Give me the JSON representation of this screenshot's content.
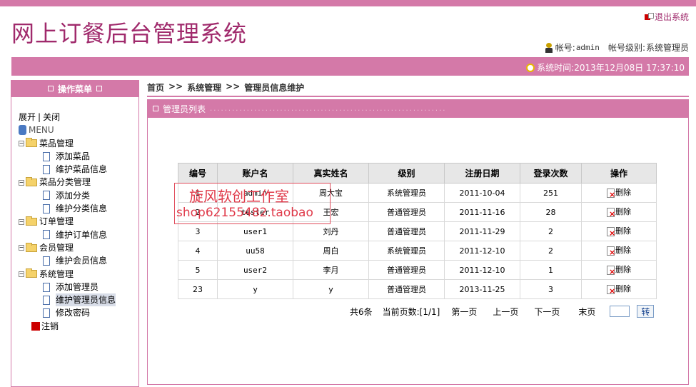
{
  "header": {
    "title": "网上订餐后台管理系统",
    "logout": "退出系统",
    "account_label": "帐号:",
    "account_value": "admin",
    "level_label": "帐号级别:",
    "level_value": "系统管理员",
    "systime_label": "系统时间:",
    "systime_value": "2013年12月08日 17:37:10"
  },
  "sidebar": {
    "title": "操作菜单",
    "expand": "展开",
    "collapse": "关闭",
    "root": "MENU",
    "groups": [
      {
        "label": "菜品管理",
        "items": [
          "添加菜品",
          "维护菜品信息"
        ]
      },
      {
        "label": "菜品分类管理",
        "items": [
          "添加分类",
          "维护分类信息"
        ]
      },
      {
        "label": "订单管理",
        "items": [
          "维护订单信息"
        ]
      },
      {
        "label": "会员管理",
        "items": [
          "维护会员信息"
        ]
      },
      {
        "label": "系统管理",
        "items": [
          "添加管理员",
          "维护管理员信息",
          "修改密码"
        ]
      }
    ],
    "logout": "注销"
  },
  "breadcrumb": [
    "首页",
    "系统管理",
    "管理员信息维护"
  ],
  "breadcrumb_sep": ">>",
  "panel": {
    "title": "管理员列表",
    "dots": "................................................................"
  },
  "table": {
    "headers": [
      "编号",
      "账户名",
      "真实姓名",
      "级别",
      "注册日期",
      "登录次数",
      "操作"
    ],
    "rows": [
      [
        "1",
        "admin",
        "周大宝",
        "系统管理员",
        "2011-10-04",
        "251"
      ],
      [
        "2",
        "tester",
        "王宏",
        "普通管理员",
        "2011-11-16",
        "28"
      ],
      [
        "3",
        "user1",
        "刘丹",
        "普通管理员",
        "2011-11-29",
        "2"
      ],
      [
        "4",
        "uu58",
        "周白",
        "系统管理员",
        "2011-12-10",
        "2"
      ],
      [
        "5",
        "user2",
        "李月",
        "普通管理员",
        "2011-12-10",
        "1"
      ],
      [
        "23",
        "y",
        "y",
        "普通管理员",
        "2013-11-25",
        "3"
      ]
    ],
    "action_label": "删除"
  },
  "watermark": {
    "line1": "旋风软创工作室",
    "line2": "shop62155482.taobao"
  },
  "pager": {
    "total": "共6条",
    "current": "当前页数:[1/1]",
    "first": "第一页",
    "prev": "上一页",
    "next": "下一页",
    "last": "末页",
    "go": "转"
  },
  "colors": {
    "accent": "#d479a8",
    "title": "#a02a6c"
  }
}
